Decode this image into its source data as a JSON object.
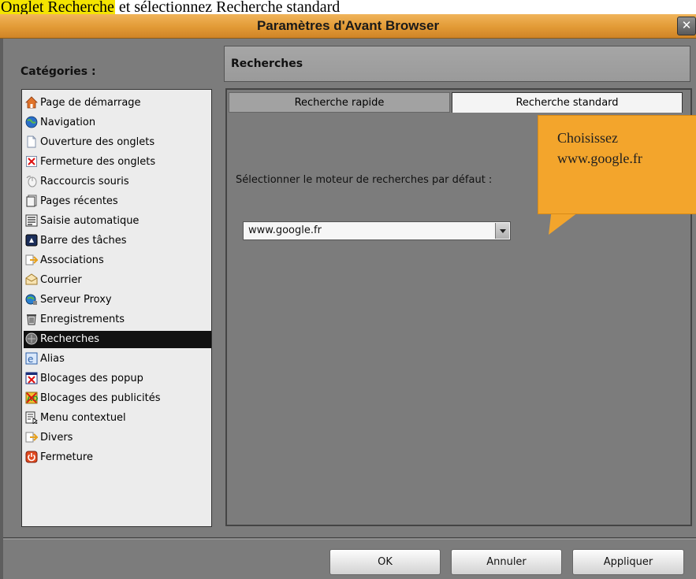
{
  "doc_strip": {
    "highlight": "Onglet Recherche",
    "text": " et sélectionnez Recherche standard"
  },
  "window": {
    "title": "Paramètres d'Avant Browser",
    "close_glyph": "✕"
  },
  "categories": {
    "label": "Catégories :",
    "items": [
      {
        "label": "Page de démarrage",
        "icon": "home-icon"
      },
      {
        "label": "Navigation",
        "icon": "globe-icon"
      },
      {
        "label": "Ouverture des onglets",
        "icon": "page-icon"
      },
      {
        "label": "Fermeture des onglets",
        "icon": "close-page-icon"
      },
      {
        "label": "Raccourcis souris",
        "icon": "mouse-icon"
      },
      {
        "label": "Pages récentes",
        "icon": "history-icon"
      },
      {
        "label": "Saisie automatique",
        "icon": "form-icon"
      },
      {
        "label": "Barre des tâches",
        "icon": "taskbar-icon"
      },
      {
        "label": "Associations",
        "icon": "associations-icon"
      },
      {
        "label": "Courrier",
        "icon": "mail-icon"
      },
      {
        "label": "Serveur Proxy",
        "icon": "proxy-icon"
      },
      {
        "label": "Enregistrements",
        "icon": "trash-icon"
      },
      {
        "label": "Recherches",
        "icon": "search-icon",
        "selected": true
      },
      {
        "label": "Alias",
        "icon": "alias-icon"
      },
      {
        "label": "Blocages des popup",
        "icon": "popup-block-icon"
      },
      {
        "label": "Blocages des publicités",
        "icon": "ad-block-icon"
      },
      {
        "label": "Menu contextuel",
        "icon": "context-menu-icon"
      },
      {
        "label": "Divers",
        "icon": "misc-icon"
      },
      {
        "label": "Fermeture",
        "icon": "power-icon"
      }
    ]
  },
  "panel": {
    "title": "Recherches",
    "tabs": [
      {
        "label": "Recherche rapide",
        "active": false
      },
      {
        "label": "Recherche standard",
        "active": true
      }
    ],
    "engine_label": "Sélectionner le moteur de recherches par défaut :",
    "engine_value": "www.google.fr"
  },
  "callout": {
    "line1": "Choisissez",
    "line2": "www.google.fr"
  },
  "buttons": {
    "ok": "OK",
    "cancel": "Annuler",
    "apply": "Appliquer"
  },
  "colors": {
    "titlebar": "#e29a35",
    "callout": "#f3a52c",
    "selection": "#111111",
    "panel_bg": "#7c7c7c"
  }
}
